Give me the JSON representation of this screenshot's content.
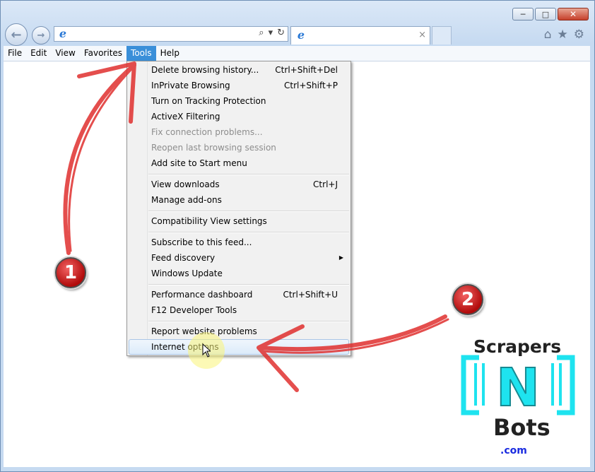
{
  "browser": {
    "window_buttons": {
      "minimize": "─",
      "maximize": "□",
      "close": "✕"
    },
    "nav": {
      "back_icon": "back-arrow-icon",
      "forward_icon": "forward-arrow-icon"
    },
    "address": {
      "value": "",
      "search_icon": "⌕",
      "dropdown_icon": "▾",
      "refresh_icon": "↻"
    },
    "tab": {
      "title": "",
      "close": "×"
    },
    "toolbar_icons": {
      "home": "⌂",
      "favorites": "★",
      "tools": "⚙"
    }
  },
  "menubar": {
    "items": [
      "File",
      "Edit",
      "View",
      "Favorites",
      "Tools",
      "Help"
    ],
    "active": "Tools"
  },
  "tools_menu": {
    "items": [
      {
        "label": "Delete browsing history...",
        "shortcut": "Ctrl+Shift+Del"
      },
      {
        "label": "InPrivate Browsing",
        "shortcut": "Ctrl+Shift+P"
      },
      {
        "label": "Turn on Tracking Protection",
        "shortcut": ""
      },
      {
        "label": "ActiveX Filtering",
        "shortcut": ""
      },
      {
        "label": "Fix connection problems...",
        "shortcut": "",
        "disabled": true
      },
      {
        "label": "Reopen last browsing session",
        "shortcut": "",
        "disabled": true
      },
      {
        "label": "Add site to Start menu",
        "shortcut": ""
      },
      {
        "label": "View downloads",
        "shortcut": "Ctrl+J"
      },
      {
        "label": "Manage add-ons",
        "shortcut": ""
      },
      {
        "label": "Compatibility View settings",
        "shortcut": ""
      },
      {
        "label": "Subscribe to this feed...",
        "shortcut": ""
      },
      {
        "label": "Feed discovery",
        "shortcut": "",
        "submenu": true
      },
      {
        "label": "Windows Update",
        "shortcut": ""
      },
      {
        "label": "Performance dashboard",
        "shortcut": "Ctrl+Shift+U"
      },
      {
        "label": "F12 Developer Tools",
        "shortcut": ""
      },
      {
        "label": "Report website problems",
        "shortcut": ""
      },
      {
        "label": "Internet options",
        "shortcut": "",
        "highlighted": true
      }
    ]
  },
  "annotations": {
    "badge_1": "1",
    "badge_2": "2",
    "arrow_color": "#e0302f"
  },
  "watermark": {
    "line1": "Scrapers",
    "mark": "N",
    "line2": "Bots",
    "line3": ".com",
    "accent": "#1ee3ef"
  }
}
